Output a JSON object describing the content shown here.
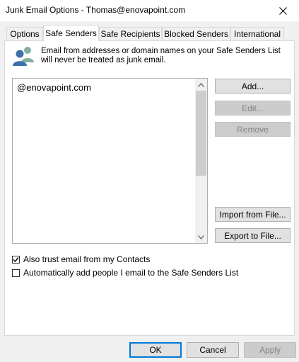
{
  "window": {
    "title": "Junk Email Options - Thomas@enovapoint.com"
  },
  "tabs": [
    {
      "label": "Options"
    },
    {
      "label": "Safe Senders"
    },
    {
      "label": "Safe Recipients"
    },
    {
      "label": "Blocked Senders"
    },
    {
      "label": "International"
    }
  ],
  "panel": {
    "info": "Email from addresses or domain names on your Safe Senders List will never be treated as junk email.",
    "list_items": [
      "@enovapoint.com"
    ],
    "buttons": {
      "add": "Add...",
      "edit": "Edit...",
      "remove": "Remove",
      "import": "Import from File...",
      "export": "Export to File..."
    },
    "checkboxes": [
      {
        "label": "Also trust email from my Contacts",
        "checked": true
      },
      {
        "label": "Automatically add people I email to the Safe Senders List",
        "checked": false
      }
    ]
  },
  "footer": {
    "ok": "OK",
    "cancel": "Cancel",
    "apply": "Apply"
  },
  "colors": {
    "accent": "#0078d7",
    "icon_blue": "#3f6fa8",
    "icon_green": "#7fb0a0"
  }
}
